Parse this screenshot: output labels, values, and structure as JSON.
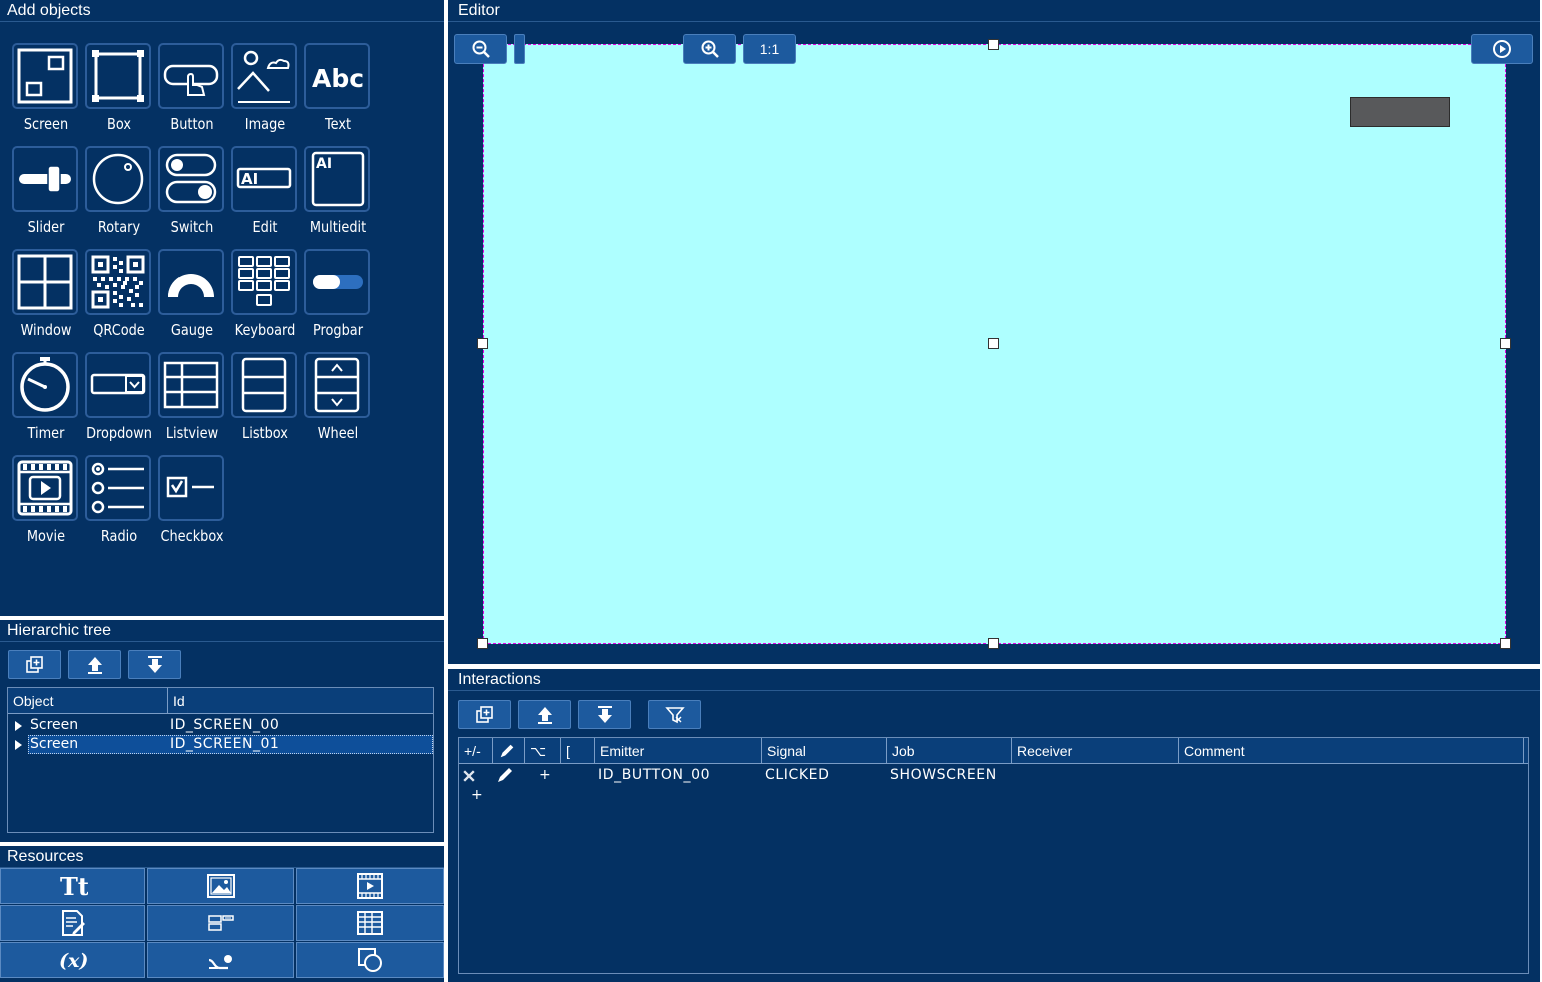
{
  "add_objects": {
    "title": "Add objects",
    "items": [
      {
        "label": "Screen",
        "icon": "screen-icon"
      },
      {
        "label": "Box",
        "icon": "box-icon"
      },
      {
        "label": "Button",
        "icon": "button-icon"
      },
      {
        "label": "Image",
        "icon": "image-icon"
      },
      {
        "label": "Text",
        "icon": "text-icon",
        "glyph": "Abc"
      },
      {
        "label": "Slider",
        "icon": "slider-icon"
      },
      {
        "label": "Rotary",
        "icon": "rotary-icon"
      },
      {
        "label": "Switch",
        "icon": "switch-icon"
      },
      {
        "label": "Edit",
        "icon": "edit-icon",
        "glyph": "AI"
      },
      {
        "label": "Multiedit",
        "icon": "multiedit-icon",
        "glyph": "AI"
      },
      {
        "label": "Window",
        "icon": "window-icon"
      },
      {
        "label": "QRCode",
        "icon": "qrcode-icon"
      },
      {
        "label": "Gauge",
        "icon": "gauge-icon"
      },
      {
        "label": "Keyboard",
        "icon": "keyboard-icon"
      },
      {
        "label": "Progbar",
        "icon": "progbar-icon"
      },
      {
        "label": "Timer",
        "icon": "timer-icon"
      },
      {
        "label": "Dropdown",
        "icon": "dropdown-icon"
      },
      {
        "label": "Listview",
        "icon": "listview-icon"
      },
      {
        "label": "Listbox",
        "icon": "listbox-icon"
      },
      {
        "label": "Wheel",
        "icon": "wheel-icon"
      },
      {
        "label": "Movie",
        "icon": "movie-icon"
      },
      {
        "label": "Radio",
        "icon": "radio-icon"
      },
      {
        "label": "Checkbox",
        "icon": "checkbox-icon"
      }
    ]
  },
  "hier_tree": {
    "title": "Hierarchic tree",
    "toolbar": [
      "add-copy-icon",
      "move-up-icon",
      "move-down-icon"
    ],
    "columns": [
      "Object",
      "Id"
    ],
    "rows": [
      {
        "object": "Screen",
        "id": "ID_SCREEN_00",
        "selected": false
      },
      {
        "object": "Screen",
        "id": "ID_SCREEN_01",
        "selected": true
      }
    ]
  },
  "resources": {
    "title": "Resources",
    "buttons": [
      "fonts-icon",
      "images-icon",
      "movies-icon",
      "text-resources-icon",
      "variables-table-icon",
      "table-icon",
      "variables-icon",
      "interpolation-icon",
      "shapes-icon"
    ],
    "variables_glyph": "(x)",
    "fonts_glyph": "Tt"
  },
  "editor": {
    "title": "Editor",
    "zoom_label": "1:1",
    "canvas_color": "#aeffff",
    "selection_color": "#e600e6"
  },
  "interactions": {
    "title": "Interactions",
    "columns": [
      "+/-",
      "",
      "⌥",
      "[",
      "Emitter",
      "Signal",
      "Job",
      "Receiver",
      "Comment"
    ],
    "rows": [
      {
        "add": "+",
        "emitter": "ID_BUTTON_00",
        "signal": "CLICKED",
        "job": "SHOWSCREEN",
        "receiver": "",
        "comment": ""
      }
    ],
    "new_row": "+"
  }
}
